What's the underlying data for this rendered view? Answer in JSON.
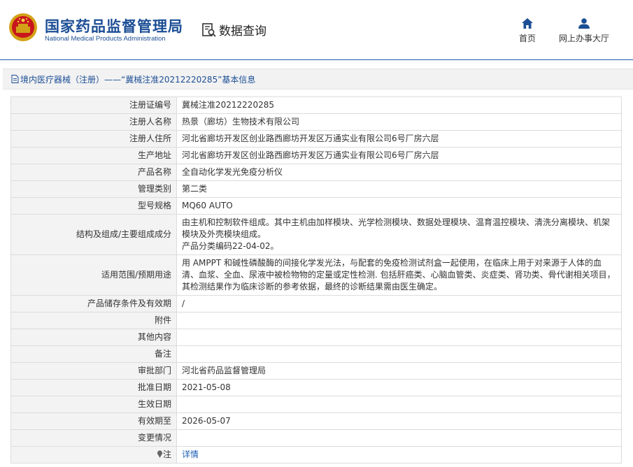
{
  "header": {
    "title_cn": "国家药品监督管理局",
    "title_en": "National Medical Products Administration",
    "query_label": "数据查询",
    "nav": [
      {
        "label": "首页",
        "icon": "home-icon"
      },
      {
        "label": "网上办事大厅",
        "icon": "user-icon"
      }
    ]
  },
  "breadcrumb": {
    "text": "境内医疗器械（注册）——“冀械注准20212220285”基本信息"
  },
  "fields": [
    {
      "label": "注册证编号",
      "value": "冀械注准20212220285"
    },
    {
      "label": "注册人名称",
      "value": "热景（廊坊）生物技术有限公司"
    },
    {
      "label": "注册人住所",
      "value": "河北省廊坊开发区创业路西廊坊开发区万通实业有限公司6号厂房六层"
    },
    {
      "label": "生产地址",
      "value": "河北省廊坊开发区创业路西廊坊开发区万通实业有限公司6号厂房六层"
    },
    {
      "label": "产品名称",
      "value": "全自动化学发光免疫分析仪"
    },
    {
      "label": "管理类别",
      "value": "第二类"
    },
    {
      "label": "型号规格",
      "value": "MQ60 AUTO"
    },
    {
      "label": "结构及组成/主要组成成分",
      "value": "由主机和控制软件组成。其中主机由加样模块、光学检测模块、数据处理模块、温育温控模块、清洗分离模块、机架模块及外壳模块组成。",
      "value2": "产品分类编码22-04-02。"
    },
    {
      "label": "适用范围/预期用途",
      "value": "用 AMPPT 和碱性磷酸酶的间接化学发光法，与配套的免疫检测试剂盒一起使用，在临床上用于对来源于人体的血清、血浆、全血、尿液中被检物物的定量或定性检测. 包括肝癌类、心脑血管类、炎症类、肾功类、骨代谢相关项目，其检测结果作为临床诊断的参考依据，最终的诊断结果需由医生确定。"
    },
    {
      "label": "产品储存条件及有效期",
      "value": "/"
    },
    {
      "label": "附件",
      "value": ""
    },
    {
      "label": "其他内容",
      "value": ""
    },
    {
      "label": "备注",
      "value": ""
    },
    {
      "label": "审批部门",
      "value": "河北省药品监督管理局"
    },
    {
      "label": "批准日期",
      "value": "2021-05-08"
    },
    {
      "label": "生效日期",
      "value": ""
    },
    {
      "label": "有效期至",
      "value": "2026-05-07"
    },
    {
      "label": "变更情况",
      "value": ""
    },
    {
      "label": "注",
      "value": "详情",
      "icon": "pin-icon"
    }
  ]
}
